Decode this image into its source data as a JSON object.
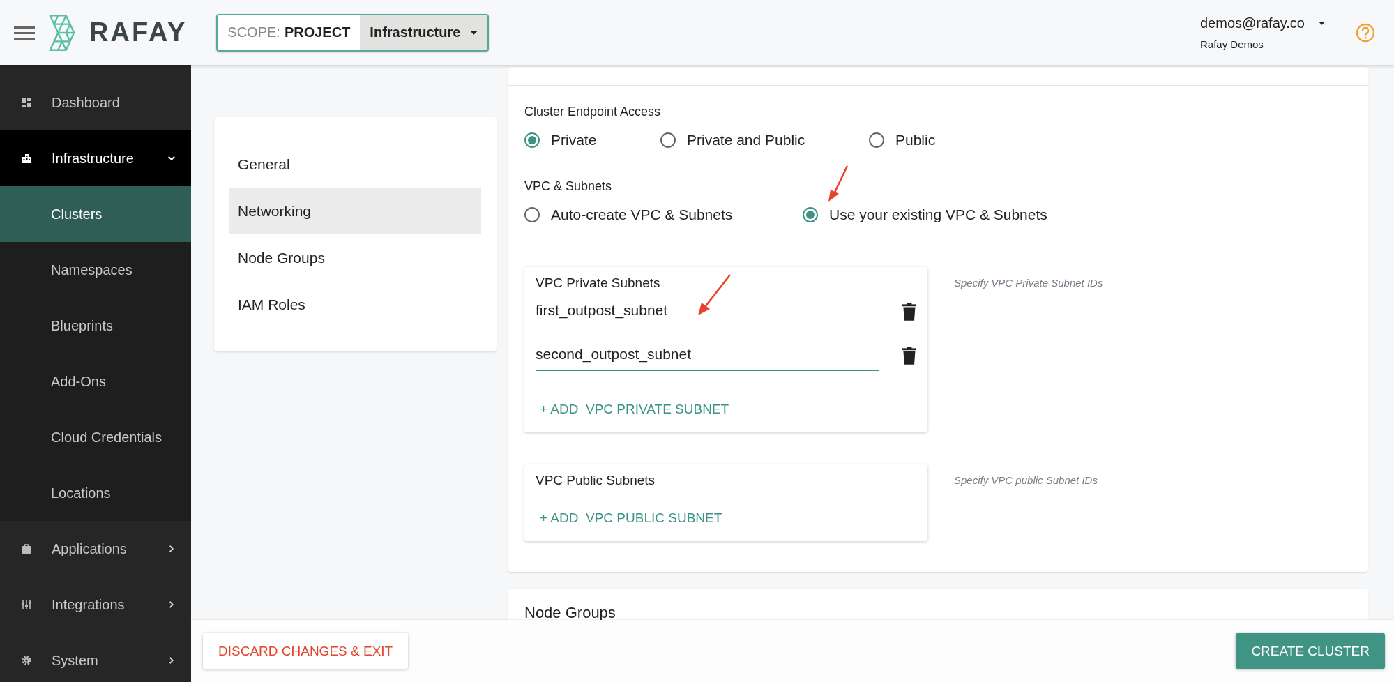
{
  "header": {
    "logo_text": "RAFAY",
    "scope_label": "SCOPE:",
    "scope_value": "PROJECT",
    "project": "Infrastructure",
    "user_email": "demos@rafay.co",
    "org": "Rafay Demos"
  },
  "sidebar": {
    "items": [
      {
        "label": "Dashboard",
        "kind": "link",
        "selected": false
      },
      {
        "label": "Infrastructure",
        "kind": "group",
        "selected": true,
        "expanded": true,
        "children": [
          {
            "label": "Clusters",
            "selected": true
          },
          {
            "label": "Namespaces",
            "selected": false
          },
          {
            "label": "Blueprints",
            "selected": false
          },
          {
            "label": "Add-Ons",
            "selected": false
          },
          {
            "label": "Cloud Credentials",
            "selected": false
          },
          {
            "label": "Locations",
            "selected": false
          }
        ]
      },
      {
        "label": "Applications",
        "kind": "group",
        "selected": false,
        "expanded": false
      },
      {
        "label": "Integrations",
        "kind": "group",
        "selected": false,
        "expanded": false
      },
      {
        "label": "System",
        "kind": "group",
        "selected": false,
        "expanded": false
      }
    ]
  },
  "settings_nav": [
    {
      "label": "General",
      "selected": false
    },
    {
      "label": "Networking",
      "selected": true
    },
    {
      "label": "Node Groups",
      "selected": false
    },
    {
      "label": "IAM Roles",
      "selected": false
    }
  ],
  "endpoint_access": {
    "label": "Cluster Endpoint Access",
    "options": [
      {
        "label": "Private",
        "selected": true
      },
      {
        "label": "Private and Public",
        "selected": false
      },
      {
        "label": "Public",
        "selected": false
      }
    ]
  },
  "vpc": {
    "label": "VPC & Subnets",
    "options": [
      {
        "label": "Auto-create VPC & Subnets",
        "selected": false
      },
      {
        "label": "Use your existing VPC & Subnets",
        "selected": true
      }
    ]
  },
  "private_subnets": {
    "title": "VPC Private Subnets",
    "hint": "Specify VPC Private Subnet IDs",
    "values": [
      {
        "value": "first_outpost_subnet",
        "focused": false
      },
      {
        "value": "second_outpost_subnet",
        "focused": true
      }
    ],
    "add_label": "+ ADD  VPC PRIVATE SUBNET"
  },
  "public_subnets": {
    "title": "VPC Public Subnets",
    "hint": "Specify VPC public Subnet IDs",
    "add_label": "+ ADD  VPC PUBLIC SUBNET"
  },
  "node_groups": {
    "title": "Node Groups"
  },
  "footer": {
    "discard": "DISCARD CHANGES & EXIT",
    "create": "CREATE CLUSTER"
  }
}
